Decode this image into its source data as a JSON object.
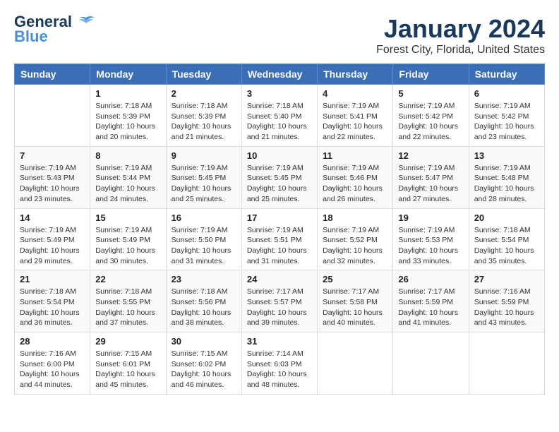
{
  "header": {
    "logo_general": "General",
    "logo_blue": "Blue",
    "month": "January 2024",
    "location": "Forest City, Florida, United States"
  },
  "weekdays": [
    "Sunday",
    "Monday",
    "Tuesday",
    "Wednesday",
    "Thursday",
    "Friday",
    "Saturday"
  ],
  "weeks": [
    [
      {
        "day": "",
        "sunrise": "",
        "sunset": "",
        "daylight": ""
      },
      {
        "day": "1",
        "sunrise": "Sunrise: 7:18 AM",
        "sunset": "Sunset: 5:39 PM",
        "daylight": "Daylight: 10 hours and 20 minutes."
      },
      {
        "day": "2",
        "sunrise": "Sunrise: 7:18 AM",
        "sunset": "Sunset: 5:39 PM",
        "daylight": "Daylight: 10 hours and 21 minutes."
      },
      {
        "day": "3",
        "sunrise": "Sunrise: 7:18 AM",
        "sunset": "Sunset: 5:40 PM",
        "daylight": "Daylight: 10 hours and 21 minutes."
      },
      {
        "day": "4",
        "sunrise": "Sunrise: 7:19 AM",
        "sunset": "Sunset: 5:41 PM",
        "daylight": "Daylight: 10 hours and 22 minutes."
      },
      {
        "day": "5",
        "sunrise": "Sunrise: 7:19 AM",
        "sunset": "Sunset: 5:42 PM",
        "daylight": "Daylight: 10 hours and 22 minutes."
      },
      {
        "day": "6",
        "sunrise": "Sunrise: 7:19 AM",
        "sunset": "Sunset: 5:42 PM",
        "daylight": "Daylight: 10 hours and 23 minutes."
      }
    ],
    [
      {
        "day": "7",
        "sunrise": "Sunrise: 7:19 AM",
        "sunset": "Sunset: 5:43 PM",
        "daylight": "Daylight: 10 hours and 23 minutes."
      },
      {
        "day": "8",
        "sunrise": "Sunrise: 7:19 AM",
        "sunset": "Sunset: 5:44 PM",
        "daylight": "Daylight: 10 hours and 24 minutes."
      },
      {
        "day": "9",
        "sunrise": "Sunrise: 7:19 AM",
        "sunset": "Sunset: 5:45 PM",
        "daylight": "Daylight: 10 hours and 25 minutes."
      },
      {
        "day": "10",
        "sunrise": "Sunrise: 7:19 AM",
        "sunset": "Sunset: 5:45 PM",
        "daylight": "Daylight: 10 hours and 25 minutes."
      },
      {
        "day": "11",
        "sunrise": "Sunrise: 7:19 AM",
        "sunset": "Sunset: 5:46 PM",
        "daylight": "Daylight: 10 hours and 26 minutes."
      },
      {
        "day": "12",
        "sunrise": "Sunrise: 7:19 AM",
        "sunset": "Sunset: 5:47 PM",
        "daylight": "Daylight: 10 hours and 27 minutes."
      },
      {
        "day": "13",
        "sunrise": "Sunrise: 7:19 AM",
        "sunset": "Sunset: 5:48 PM",
        "daylight": "Daylight: 10 hours and 28 minutes."
      }
    ],
    [
      {
        "day": "14",
        "sunrise": "Sunrise: 7:19 AM",
        "sunset": "Sunset: 5:49 PM",
        "daylight": "Daylight: 10 hours and 29 minutes."
      },
      {
        "day": "15",
        "sunrise": "Sunrise: 7:19 AM",
        "sunset": "Sunset: 5:49 PM",
        "daylight": "Daylight: 10 hours and 30 minutes."
      },
      {
        "day": "16",
        "sunrise": "Sunrise: 7:19 AM",
        "sunset": "Sunset: 5:50 PM",
        "daylight": "Daylight: 10 hours and 31 minutes."
      },
      {
        "day": "17",
        "sunrise": "Sunrise: 7:19 AM",
        "sunset": "Sunset: 5:51 PM",
        "daylight": "Daylight: 10 hours and 31 minutes."
      },
      {
        "day": "18",
        "sunrise": "Sunrise: 7:19 AM",
        "sunset": "Sunset: 5:52 PM",
        "daylight": "Daylight: 10 hours and 32 minutes."
      },
      {
        "day": "19",
        "sunrise": "Sunrise: 7:19 AM",
        "sunset": "Sunset: 5:53 PM",
        "daylight": "Daylight: 10 hours and 33 minutes."
      },
      {
        "day": "20",
        "sunrise": "Sunrise: 7:18 AM",
        "sunset": "Sunset: 5:54 PM",
        "daylight": "Daylight: 10 hours and 35 minutes."
      }
    ],
    [
      {
        "day": "21",
        "sunrise": "Sunrise: 7:18 AM",
        "sunset": "Sunset: 5:54 PM",
        "daylight": "Daylight: 10 hours and 36 minutes."
      },
      {
        "day": "22",
        "sunrise": "Sunrise: 7:18 AM",
        "sunset": "Sunset: 5:55 PM",
        "daylight": "Daylight: 10 hours and 37 minutes."
      },
      {
        "day": "23",
        "sunrise": "Sunrise: 7:18 AM",
        "sunset": "Sunset: 5:56 PM",
        "daylight": "Daylight: 10 hours and 38 minutes."
      },
      {
        "day": "24",
        "sunrise": "Sunrise: 7:17 AM",
        "sunset": "Sunset: 5:57 PM",
        "daylight": "Daylight: 10 hours and 39 minutes."
      },
      {
        "day": "25",
        "sunrise": "Sunrise: 7:17 AM",
        "sunset": "Sunset: 5:58 PM",
        "daylight": "Daylight: 10 hours and 40 minutes."
      },
      {
        "day": "26",
        "sunrise": "Sunrise: 7:17 AM",
        "sunset": "Sunset: 5:59 PM",
        "daylight": "Daylight: 10 hours and 41 minutes."
      },
      {
        "day": "27",
        "sunrise": "Sunrise: 7:16 AM",
        "sunset": "Sunset: 5:59 PM",
        "daylight": "Daylight: 10 hours and 43 minutes."
      }
    ],
    [
      {
        "day": "28",
        "sunrise": "Sunrise: 7:16 AM",
        "sunset": "Sunset: 6:00 PM",
        "daylight": "Daylight: 10 hours and 44 minutes."
      },
      {
        "day": "29",
        "sunrise": "Sunrise: 7:15 AM",
        "sunset": "Sunset: 6:01 PM",
        "daylight": "Daylight: 10 hours and 45 minutes."
      },
      {
        "day": "30",
        "sunrise": "Sunrise: 7:15 AM",
        "sunset": "Sunset: 6:02 PM",
        "daylight": "Daylight: 10 hours and 46 minutes."
      },
      {
        "day": "31",
        "sunrise": "Sunrise: 7:14 AM",
        "sunset": "Sunset: 6:03 PM",
        "daylight": "Daylight: 10 hours and 48 minutes."
      },
      {
        "day": "",
        "sunrise": "",
        "sunset": "",
        "daylight": ""
      },
      {
        "day": "",
        "sunrise": "",
        "sunset": "",
        "daylight": ""
      },
      {
        "day": "",
        "sunrise": "",
        "sunset": "",
        "daylight": ""
      }
    ]
  ]
}
